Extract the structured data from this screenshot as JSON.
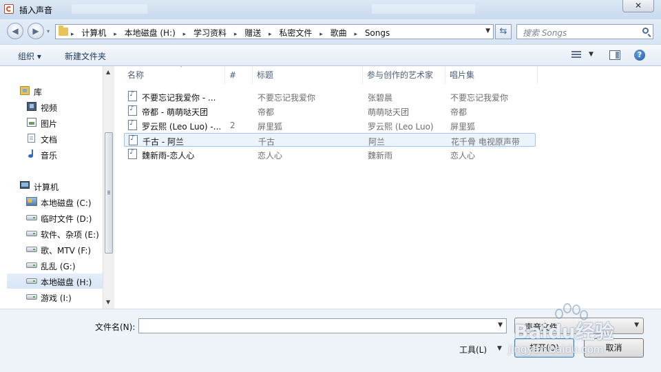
{
  "window": {
    "title": "插入声音",
    "close_symbol": "✕"
  },
  "toolbar": {
    "back_symbol": "◀",
    "forward_symbol": "▶",
    "history_drop": "▾",
    "breadcrumbs": [
      "计算机",
      "本地磁盘 (H:)",
      "学习资料",
      "赠送",
      "私密文件",
      "歌曲",
      "Songs"
    ],
    "crumb_separator": "▸",
    "address_drop": "▼",
    "refresh_symbol": "⇆",
    "search_placeholder": "搜索 Songs"
  },
  "commands": {
    "organize": "组织 ▾",
    "new_folder": "新建文件夹",
    "view_drop": "▼",
    "help": "?"
  },
  "nav": {
    "library": "库",
    "videos": "视频",
    "pictures": "图片",
    "documents": "文档",
    "music": "音乐",
    "computer": "计算机",
    "drives": [
      {
        "label": "本地磁盘 (C:)"
      },
      {
        "label": "临时文件 (D:)"
      },
      {
        "label": "软件、杂项 (E:)"
      },
      {
        "label": "歌、MTV (F:)"
      },
      {
        "label": "乱乱 (G:)"
      },
      {
        "label": "本地磁盘 (H:)"
      },
      {
        "label": "游戏 (I:)"
      }
    ],
    "scroll_up": "▲",
    "scroll_down": "▼"
  },
  "columns": {
    "name": "名称",
    "number": "#",
    "title": "标题",
    "artist": "参与创作的艺术家",
    "album": "唱片集",
    "sort_indicator": "˄"
  },
  "files": [
    {
      "name": "不要忘记我爱你 - ...",
      "number": "",
      "title": "不要忘记我爱你",
      "artist": "张碧晨",
      "album": "不要忘记我爱你"
    },
    {
      "name": "帝都 - 萌萌哒天团",
      "number": "",
      "title": "帝都",
      "artist": "萌萌哒天团",
      "album": "帝都"
    },
    {
      "name": "罗云熙 (Leo Luo) -...",
      "number": "2",
      "title": "屏里狐",
      "artist": "罗云熙 (Leo Luo)",
      "album": "屏里狐"
    },
    {
      "name": "千古 - 阿兰",
      "number": "",
      "title": "千古",
      "artist": "阿兰",
      "album": "花千骨 电视原声带"
    },
    {
      "name": "魏新雨-恋人心",
      "number": "",
      "title": "恋人心",
      "artist": "魏新雨",
      "album": "恋人心"
    }
  ],
  "bottom": {
    "filename_label": "文件名(N):",
    "filename_value": "",
    "filename_drop": "▼",
    "filter_value": "声音文件",
    "filter_drop": "▼",
    "tools_label": "工具(L)",
    "tools_drop": "▼",
    "open_label": "打开(O)",
    "cancel_label": "取消"
  },
  "watermark": {
    "logo": "Baidu经验",
    "url": "jingyan.baidu.com"
  }
}
